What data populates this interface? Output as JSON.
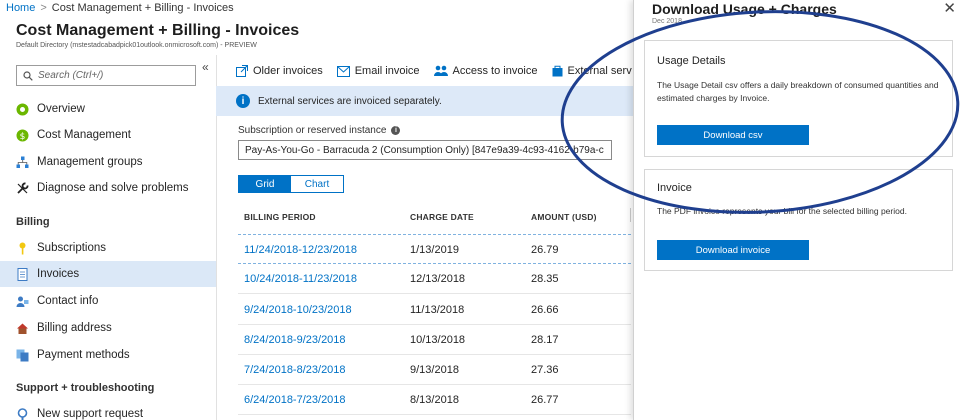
{
  "breadcrumb": {
    "home": "Home",
    "current": "Cost Management + Billing - Invoices"
  },
  "blade": {
    "title": "Cost Management + Billing - Invoices",
    "subtitle": "Default Directory (mstestadcabadpick01outlook.onmicrosoft.com) - PREVIEW"
  },
  "search": {
    "placeholder": "Search (Ctrl+/)"
  },
  "nav": {
    "items": [
      {
        "label": "Overview"
      },
      {
        "label": "Cost Management"
      },
      {
        "label": "Management groups"
      },
      {
        "label": "Diagnose and solve problems"
      }
    ],
    "billing_header": "Billing",
    "billing_items": [
      {
        "label": "Subscriptions"
      },
      {
        "label": "Invoices"
      },
      {
        "label": "Contact info"
      },
      {
        "label": "Billing address"
      },
      {
        "label": "Payment methods"
      }
    ],
    "support_header": "Support + troubleshooting",
    "support_items": [
      {
        "label": "New support request"
      }
    ]
  },
  "toolbar": {
    "older": "Older invoices",
    "email": "Email invoice",
    "access": "Access to invoice",
    "external": "External services"
  },
  "info": {
    "text": "External services are invoiced separately."
  },
  "subscription": {
    "label": "Subscription or reserved instance",
    "value": "Pay-As-You-Go - Barracuda 2 (Consumption Only) [847e9a39-4c93-4162-b79a-c"
  },
  "view_toggle": {
    "grid": "Grid",
    "chart": "Chart"
  },
  "table": {
    "headers": {
      "period": "BILLING PERIOD",
      "date": "CHARGE DATE",
      "amount": "AMOUNT (USD)"
    },
    "rows": [
      {
        "period": "11/24/2018-12/23/2018",
        "date": "1/13/2019",
        "amount": "26.79"
      },
      {
        "period": "10/24/2018-11/23/2018",
        "date": "12/13/2018",
        "amount": "28.35"
      },
      {
        "period": "9/24/2018-10/23/2018",
        "date": "11/13/2018",
        "amount": "26.66"
      },
      {
        "period": "8/24/2018-9/23/2018",
        "date": "10/13/2018",
        "amount": "28.17"
      },
      {
        "period": "7/24/2018-8/23/2018",
        "date": "9/13/2018",
        "amount": "27.36"
      },
      {
        "period": "6/24/2018-7/23/2018",
        "date": "8/13/2018",
        "amount": "26.77"
      }
    ]
  },
  "panel": {
    "title": "Download Usage + Charges",
    "subtitle": "Dec 2018",
    "usage": {
      "title": "Usage Details",
      "desc": "The Usage Detail csv offers a daily breakdown of consumed quantities and estimated charges by Invoice.",
      "button": "Download csv"
    },
    "invoice": {
      "title": "Invoice",
      "desc": "The PDF invoice represents your bill for the selected billing period.",
      "button": "Download invoice"
    }
  },
  "colors": {
    "accent": "#0072c6",
    "info_bg": "#dde9f8",
    "annotation": "#1f3f8f"
  }
}
